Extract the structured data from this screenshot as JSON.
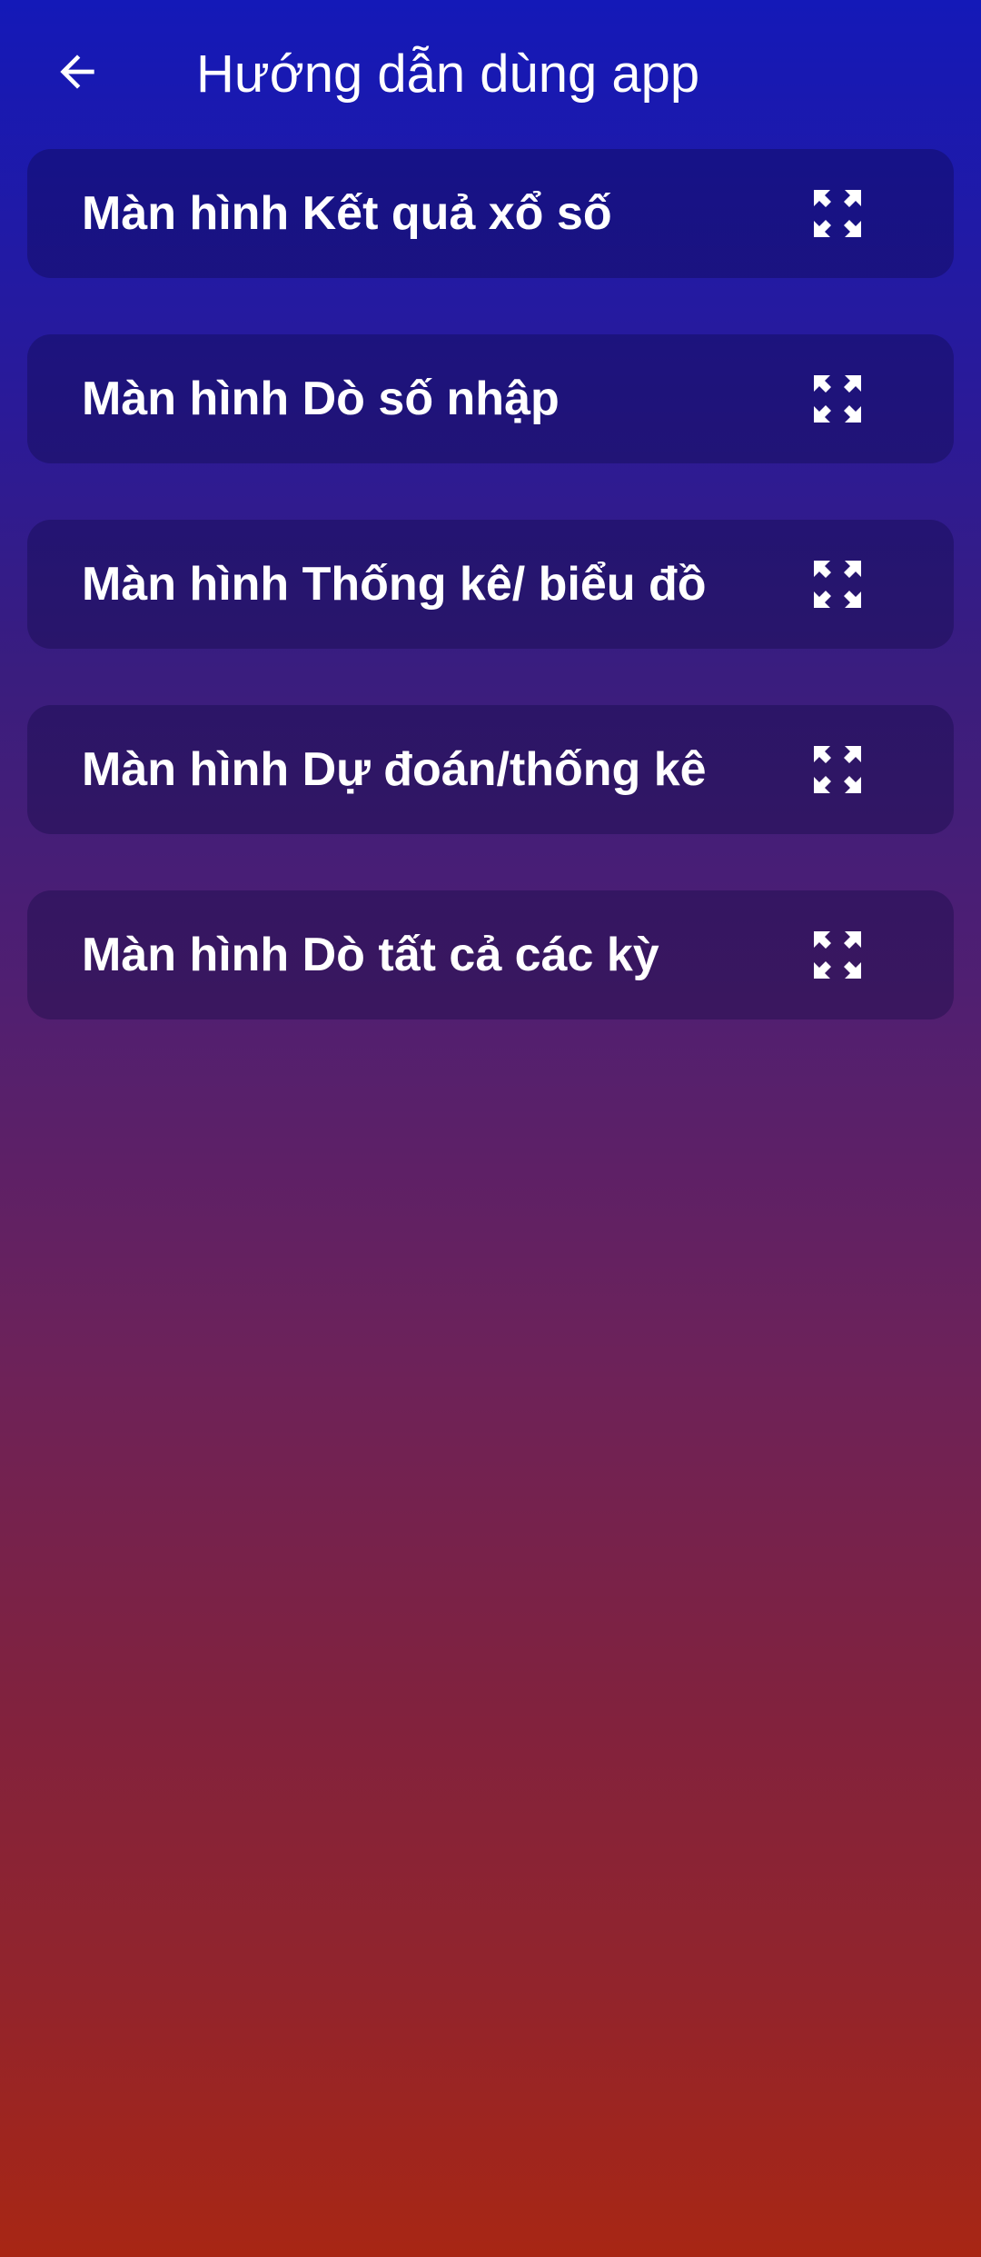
{
  "header": {
    "title": "Hướng dẫn dùng app",
    "back_icon": "arrow-left-icon"
  },
  "guide_items": [
    {
      "label": "Màn hình Kết quả xổ số",
      "icon": "expand-icon"
    },
    {
      "label": "Màn hình Dò số nhập",
      "icon": "expand-icon"
    },
    {
      "label": "Màn hình Thống kê/ biểu đồ",
      "icon": "expand-icon"
    },
    {
      "label": "Màn hình Dự đoán/thống kê",
      "icon": "expand-icon"
    },
    {
      "label": "Màn hình Dò tất cả các kỳ",
      "icon": "expand-icon"
    }
  ],
  "colors": {
    "gradient_top": "#1419b8",
    "gradient_bottom": "#a82614",
    "text": "#ffffff"
  }
}
